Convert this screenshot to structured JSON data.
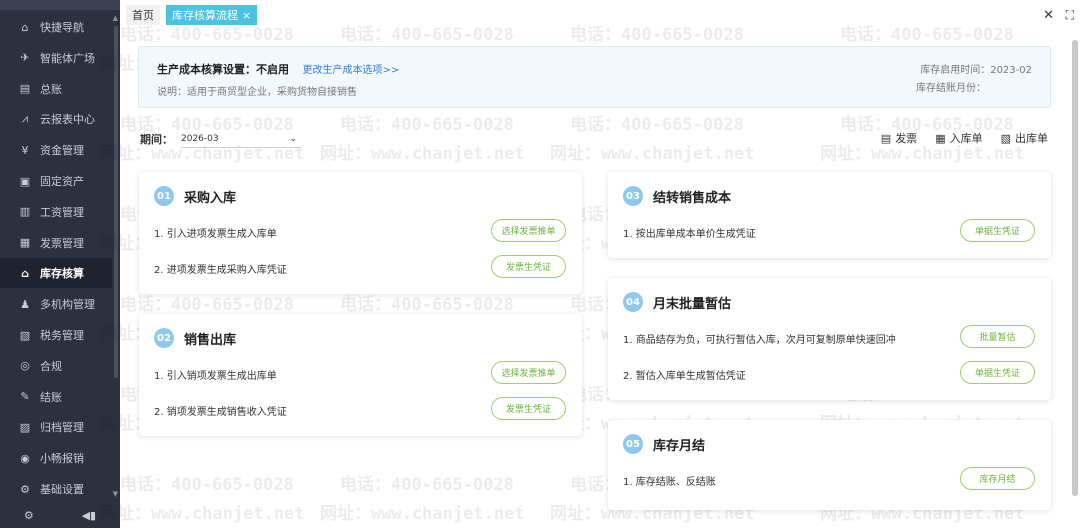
{
  "sidebar": {
    "items": [
      {
        "label": "快捷导航",
        "icon": "home-icon"
      },
      {
        "label": "智能体广场",
        "icon": "rocket-icon"
      },
      {
        "label": "总账",
        "icon": "ledger-icon"
      },
      {
        "label": "云报表中心",
        "icon": "chart-icon"
      },
      {
        "label": "资金管理",
        "icon": "money-icon"
      },
      {
        "label": "固定资产",
        "icon": "asset-icon"
      },
      {
        "label": "工资管理",
        "icon": "salary-icon"
      },
      {
        "label": "发票管理",
        "icon": "invoice-icon"
      },
      {
        "label": "库存核算",
        "icon": "inventory-icon"
      },
      {
        "label": "多机构管理",
        "icon": "org-icon"
      },
      {
        "label": "税务管理",
        "icon": "tax-icon"
      },
      {
        "label": "合规",
        "icon": "shield-icon"
      },
      {
        "label": "结账",
        "icon": "close-book-icon"
      },
      {
        "label": "归档管理",
        "icon": "archive-icon"
      },
      {
        "label": "小畅报销",
        "icon": "reimburse-icon"
      },
      {
        "label": "基础设置",
        "icon": "settings-icon"
      }
    ],
    "active_index": 8
  },
  "tabs": [
    {
      "label": "首页"
    },
    {
      "label": "库存核算流程",
      "closable": "×"
    }
  ],
  "info": {
    "setting_label": "生产成本核算设置：不启用",
    "change_link": "更改生产成本选项>>",
    "description": "说明：适用于商贸型企业，采购货物自接销售",
    "enable_time": "库存启用时间：2023-02",
    "closing_month": "库存结账月份："
  },
  "period": {
    "label": "期间：",
    "value": "2026-03"
  },
  "doc_links": [
    {
      "label": "发票",
      "icon": "invoice-doc-icon"
    },
    {
      "label": "入库单",
      "icon": "inbound-doc-icon"
    },
    {
      "label": "出库单",
      "icon": "outbound-doc-icon"
    }
  ],
  "cards": {
    "c1": {
      "num": "01",
      "title": "采购入库",
      "rows": [
        "1. 引入进项发票生成入库单",
        "2. 进项发票生成采购入库凭证"
      ],
      "buttons": [
        "选择发票推单",
        "发票生凭证"
      ]
    },
    "c2": {
      "num": "02",
      "title": "销售出库",
      "rows": [
        "1. 引入销项发票生成出库单",
        "2. 销项发票生成销售收入凭证"
      ],
      "buttons": [
        "选择发票推单",
        "发票生凭证"
      ]
    },
    "c3": {
      "num": "03",
      "title": "结转销售成本",
      "rows": [
        "1. 按出库单成本单价生成凭证"
      ],
      "buttons": [
        "单据生凭证"
      ]
    },
    "c4": {
      "num": "04",
      "title": "月末批量暂估",
      "rows": [
        "1. 商品结存为负，可执行暂估入库，次月可复制原单快速回冲",
        "2. 暂估入库单生成暂估凭证"
      ],
      "buttons": [
        "批量暂估",
        "单据生凭证"
      ]
    },
    "c5": {
      "num": "05",
      "title": "库存月结",
      "rows": [
        "1. 库存结账、反结账"
      ],
      "buttons": [
        "库存月结"
      ]
    }
  },
  "watermark": {
    "phone": "电话：400-665-0028",
    "site": "网址：www.chanjet.net"
  }
}
